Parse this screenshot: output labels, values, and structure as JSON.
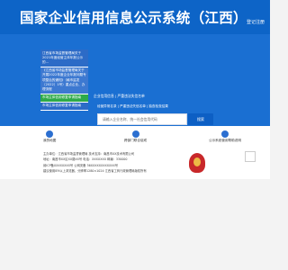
{
  "header": {
    "title": "国家企业信用信息公示系统（江西）",
    "login": "登记注册"
  },
  "notices": [
    "江西省市场监督管理局关于2021年度经营主体年报公示的...",
    "《江西省市场监督管理局关于开展2022年度企业年报问题专项整治的通知》（赣市监发〔2022〕1号）重点企业、办理流程",
    "市场主体信用修复申请指南",
    "市场主体信用修复申请指南"
  ],
  "main": {
    "tabs": "企业信用信息 | 严重违法失信名单",
    "subtabs": "经营异常名录 | 严重违法失信名单 | 抽查检查结果",
    "search_placeholder": "请输入企业名称、统一社会信用代码",
    "search_button": "搜索"
  },
  "features": [
    {
      "label": "我的地图"
    },
    {
      "label": "跨部门联合惩戒"
    },
    {
      "label": "公示系统使用帮助说明"
    }
  ],
  "footer": {
    "lines": [
      "主办单位：江西省市场监督管理局  技术支持：南昌市XX技术有限公司",
      "地址：南昌市XX区XX路XX号  电话：XXXXXXX  邮编：330000",
      "赣ICP备XXXXXXXX号  公网安备 36XXXXXXXXXXXX号",
      "建议使用IE9以上浏览器，分辨率1280×1024 江西省工商行政管理局版权所有"
    ]
  }
}
